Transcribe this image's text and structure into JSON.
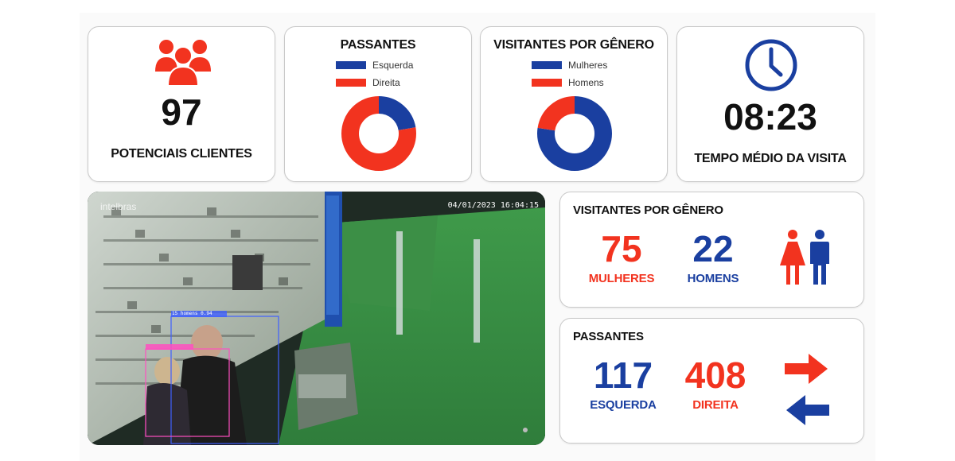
{
  "colors": {
    "blue": "#1a3fa0",
    "red": "#f2331f",
    "border": "#c9c9c9"
  },
  "clients": {
    "icon": "people-group-icon",
    "count": "97",
    "label": "POTENCIAIS CLIENTES"
  },
  "passantes_chart": {
    "title": "PASSANTES",
    "legend": [
      {
        "label": "Esquerda",
        "color": "#1a3fa0"
      },
      {
        "label": "Direita",
        "color": "#f2331f"
      }
    ],
    "chart_data": {
      "type": "pie",
      "categories": [
        "Esquerda",
        "Direita"
      ],
      "values": [
        117,
        408
      ]
    }
  },
  "gender_chart": {
    "title": "VISITANTES POR GÊNERO",
    "legend": [
      {
        "label": "Mulheres",
        "color": "#1a3fa0"
      },
      {
        "label": "Homens",
        "color": "#f2331f"
      }
    ],
    "chart_data": {
      "type": "pie",
      "categories": [
        "Mulheres",
        "Homens"
      ],
      "values": [
        75,
        22
      ]
    }
  },
  "visit_time": {
    "icon": "clock-icon",
    "value": "08:23",
    "label": "TEMPO MÉDIO DA VISITA"
  },
  "camera": {
    "timestamp": "04/01/2023 16:04:15",
    "watermark": "intelbras",
    "detection_label": "15 homens 0.94"
  },
  "gender_stats": {
    "title": "VISITANTES POR GÊNERO",
    "women": {
      "value": "75",
      "label": "MULHERES"
    },
    "men": {
      "value": "22",
      "label": "HOMENS"
    },
    "icon": "woman-man-icon"
  },
  "passantes_stats": {
    "title": "PASSANTES",
    "left": {
      "value": "117",
      "label": "ESQUERDA"
    },
    "right": {
      "value": "408",
      "label": "DIREITA"
    },
    "icon": "swap-arrows-icon"
  }
}
